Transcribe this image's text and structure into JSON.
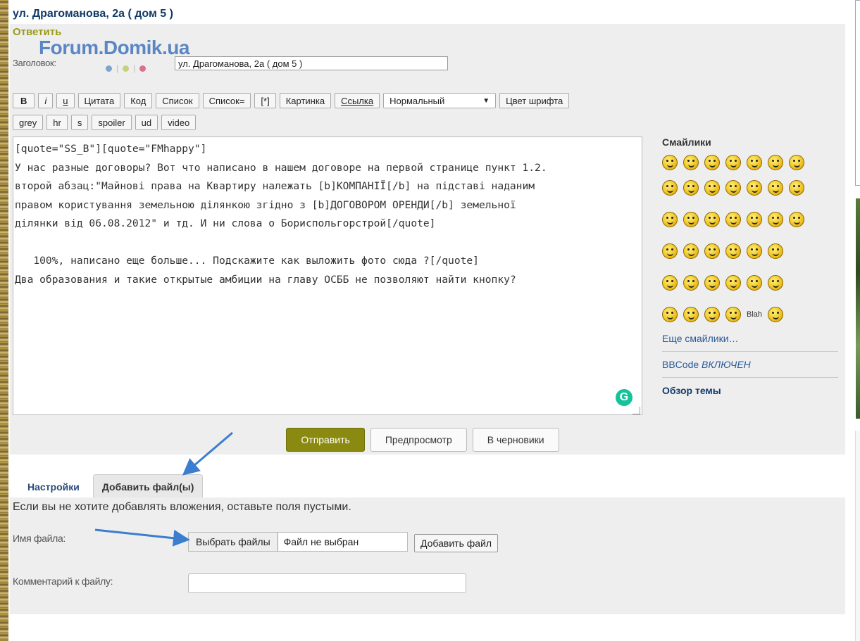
{
  "topic_title": "ул. Драгоманова, 2а ( дом 5 )",
  "reply_label": "Ответить",
  "logo": "Forum.Domik.ua",
  "subject": {
    "label": "Заголовок:",
    "value": "ул. Драгоманова, 2а ( дом 5 )"
  },
  "colors": {
    "dot1": "#7fa3cf",
    "dot2": "#c5d27a",
    "dot3": "#d7738c",
    "submit": "#8a8a10"
  },
  "toolbar1": [
    "B",
    "i",
    "u",
    "Цитата",
    "Код",
    "Список",
    "Список=",
    "[*]",
    "Картинка",
    "Ссылка"
  ],
  "font_size_select": "Нормальный",
  "font_color_button": "Цвет шрифта",
  "toolbar2": [
    "grey",
    "hr",
    "s",
    "spoiler",
    "ud",
    "video"
  ],
  "message_lines": [
    "[quote=\"SS_B\"][quote=\"FMhappy\"]",
    "У нас разные договоры? Вот что написано в нашем договоре на первой странице пункт 1.2.",
    "второй абзац:\"Майнові права на Квартиру належать [b]КОМПАНІЇ[/b] на підставі наданим",
    "правом користування земельною ділянкою згідно з [b]ДОГОВОРОМ ОРЕНДИ[/b] земельної",
    "ділянки від 06.08.2012\" и тд. И ни слова о Бориспольгорстрой[/quote]",
    "",
    "   100%, написано еще больше... Подскажите как выложить фото сюда ?[/quote]",
    "Два образования и такие открытые амбиции на главу ОСББ не позволяют найти кнопку?"
  ],
  "grammarly_icon": "G",
  "smilies": {
    "title": "Смайлики",
    "more": "Еще смайлики…",
    "blah_label": "Blah",
    "bbcode_prefix": "BBCode",
    "bbcode_status": "ВКЛЮЧЕН",
    "review": "Обзор темы"
  },
  "buttons": {
    "submit": "Отправить",
    "preview": "Предпросмотр",
    "draft": "В черновики"
  },
  "tabs": [
    "Настройки",
    "Добавить файл(ы)"
  ],
  "attachments": {
    "hint": "Если вы не хотите добавлять вложения, оставьте поля пустыми.",
    "filename_label": "Имя файла:",
    "choose_button": "Выбрать файлы",
    "no_file": "Файл не выбран",
    "add_button": "Добавить файл",
    "comment_label": "Комментарий к файлу:"
  }
}
